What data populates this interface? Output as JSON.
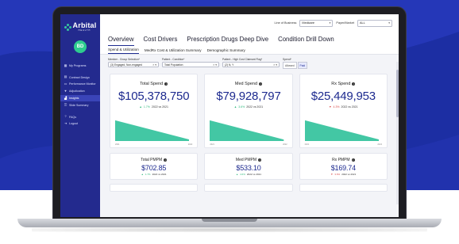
{
  "app": {
    "logo_word": "Arbital",
    "logo_sub": "HEALTH",
    "user_initials": "BD"
  },
  "sidebar": {
    "items": [
      {
        "label": "My Programs",
        "icon": "grid-icon"
      },
      {
        "label": "Contract Design",
        "icon": "document-icon"
      },
      {
        "label": "Performance Monitor",
        "icon": "monitor-icon"
      },
      {
        "label": "Adjudication",
        "icon": "heart-icon"
      },
      {
        "label": "Insights",
        "icon": "chart-icon"
      },
      {
        "label": "Slide Summary",
        "icon": "slides-icon"
      }
    ],
    "footer": [
      {
        "label": "FAQs",
        "icon": "help-icon"
      },
      {
        "label": "Logout",
        "icon": "logout-icon"
      }
    ],
    "active_item": "Insights"
  },
  "topbar": {
    "line_of_business_label": "Line of Business",
    "line_of_business_value": "Medicare",
    "payer_label": "Payer/Market",
    "payer_value": "ALL"
  },
  "primary_tabs": [
    "Overview",
    "Cost Drivers",
    "Prescription Drugs Deep Dive",
    "Condition Drill Down"
  ],
  "active_primary_tab": "Overview",
  "secondary_tabs": [
    "Spend & Utilization",
    "MedRx Cost & Utilization Summary",
    "Demographic Summary"
  ],
  "active_secondary_tab": "Spend & Utilization",
  "filters": {
    "member_group": {
      "label": "Member - Group Selection*",
      "value": "(3) Engaged, Non-engaged"
    },
    "patient_condition": {
      "label": "Patient - Condition*",
      "value": "Total Population"
    },
    "patient_claimant": {
      "label": "Patient - High Cost Claimant Flag*",
      "value": "(2) N, Y"
    },
    "spend": {
      "label": "Spend*",
      "options": [
        "Allowed",
        "Paid"
      ],
      "active": "Paid"
    }
  },
  "kpi_cards": [
    {
      "title": "Total Spend",
      "value": "$105,378,750",
      "pct": "1.7%",
      "direction": "up",
      "compare": "2022 vs 2021",
      "axis_start": "2021",
      "axis_end": "2022"
    },
    {
      "title": "Med Spend",
      "value": "$79,928,797",
      "pct": "3.6%",
      "direction": "up",
      "compare": "2022 vs 2021",
      "axis_start": "2021",
      "axis_end": "2022"
    },
    {
      "title": "Rx Spend",
      "value": "$25,449,953",
      "pct": "4.3%",
      "direction": "down",
      "compare": "2022 vs 2021",
      "axis_start": "2021",
      "axis_end": "2022"
    }
  ],
  "pmpm_cards": [
    {
      "title": "Total PMPM",
      "value": "$702.85",
      "pct": "1.7%",
      "direction": "up",
      "compare": "2022 vs 2021"
    },
    {
      "title": "Med PMPM",
      "value": "$533.10",
      "pct": "4.6%",
      "direction": "up",
      "compare": "2022 vs 2021"
    },
    {
      "title": "Rx PMPM",
      "value": "$169.74",
      "pct": "3.6%",
      "direction": "down",
      "compare": "2022 vs 2021"
    }
  ],
  "colors": {
    "sidebar": "#232a8e",
    "accent": "#1d2a8f",
    "trend_fill": "#43c7a4",
    "up": "#2eb87c",
    "down": "#d84c4c",
    "background": "#1c2ea3"
  }
}
